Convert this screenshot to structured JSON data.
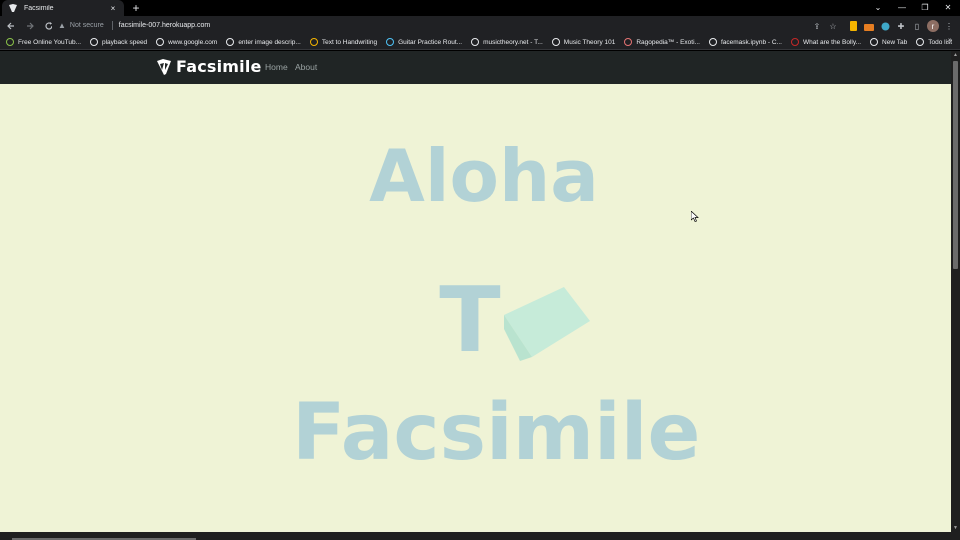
{
  "browser": {
    "tab_title": "Facsimile",
    "new_tab_symbol": "+",
    "close_symbol": "×",
    "not_secure_label": "Not secure",
    "url": "facsimile-007.herokuapp.com",
    "window_controls": {
      "dropdown": "⌄",
      "minimize": "—",
      "restore": "❐",
      "close": "✕"
    },
    "profile_initial": "r"
  },
  "bookmarks": [
    {
      "label": "Free Online YouTub...",
      "icon": "youtube-to-mp3-icon",
      "color": "#8bc34a"
    },
    {
      "label": "playback speed",
      "icon": "globe-icon",
      "color": "#e8eaed"
    },
    {
      "label": "www.google.com",
      "icon": "globe-icon",
      "color": "#e8eaed"
    },
    {
      "label": "enter image descrip...",
      "icon": "globe-icon",
      "color": "#e8eaed"
    },
    {
      "label": "Text to Handwriting",
      "icon": "handwriting-icon",
      "color": "#f4b400"
    },
    {
      "label": "Guitar Practice Rout...",
      "icon": "guitar-icon",
      "color": "#4fc3f7"
    },
    {
      "label": "musictheory.net - T...",
      "icon": "music-icon",
      "color": "#e8eaed"
    },
    {
      "label": "Music Theory 101",
      "icon": "page-icon",
      "color": "#e8eaed"
    },
    {
      "label": "Ragopedia™ - Exoti...",
      "icon": "ragopedia-icon",
      "color": "#e57373"
    },
    {
      "label": "facemask.ipynb - C...",
      "icon": "globe-icon",
      "color": "#e8eaed"
    },
    {
      "label": "What are the Bolly...",
      "icon": "quora-icon",
      "color": "#c62828"
    },
    {
      "label": "New Tab",
      "icon": "globe-icon",
      "color": "#e8eaed"
    },
    {
      "label": "Todo list",
      "icon": "todo-icon",
      "color": "#e8eaed"
    }
  ],
  "bookmarks_more": "»",
  "site": {
    "brand": "Facsimile",
    "nav": [
      {
        "label": "Home"
      },
      {
        "label": "About"
      }
    ],
    "hero": {
      "line1": "Aloha",
      "line2": "T",
      "line3": "Facsimile"
    }
  },
  "colors": {
    "page_bg": "#eff3d6",
    "navbar_bg": "#202525",
    "hero_text": "#b2d2d6",
    "cube": "#c6ebd9"
  }
}
